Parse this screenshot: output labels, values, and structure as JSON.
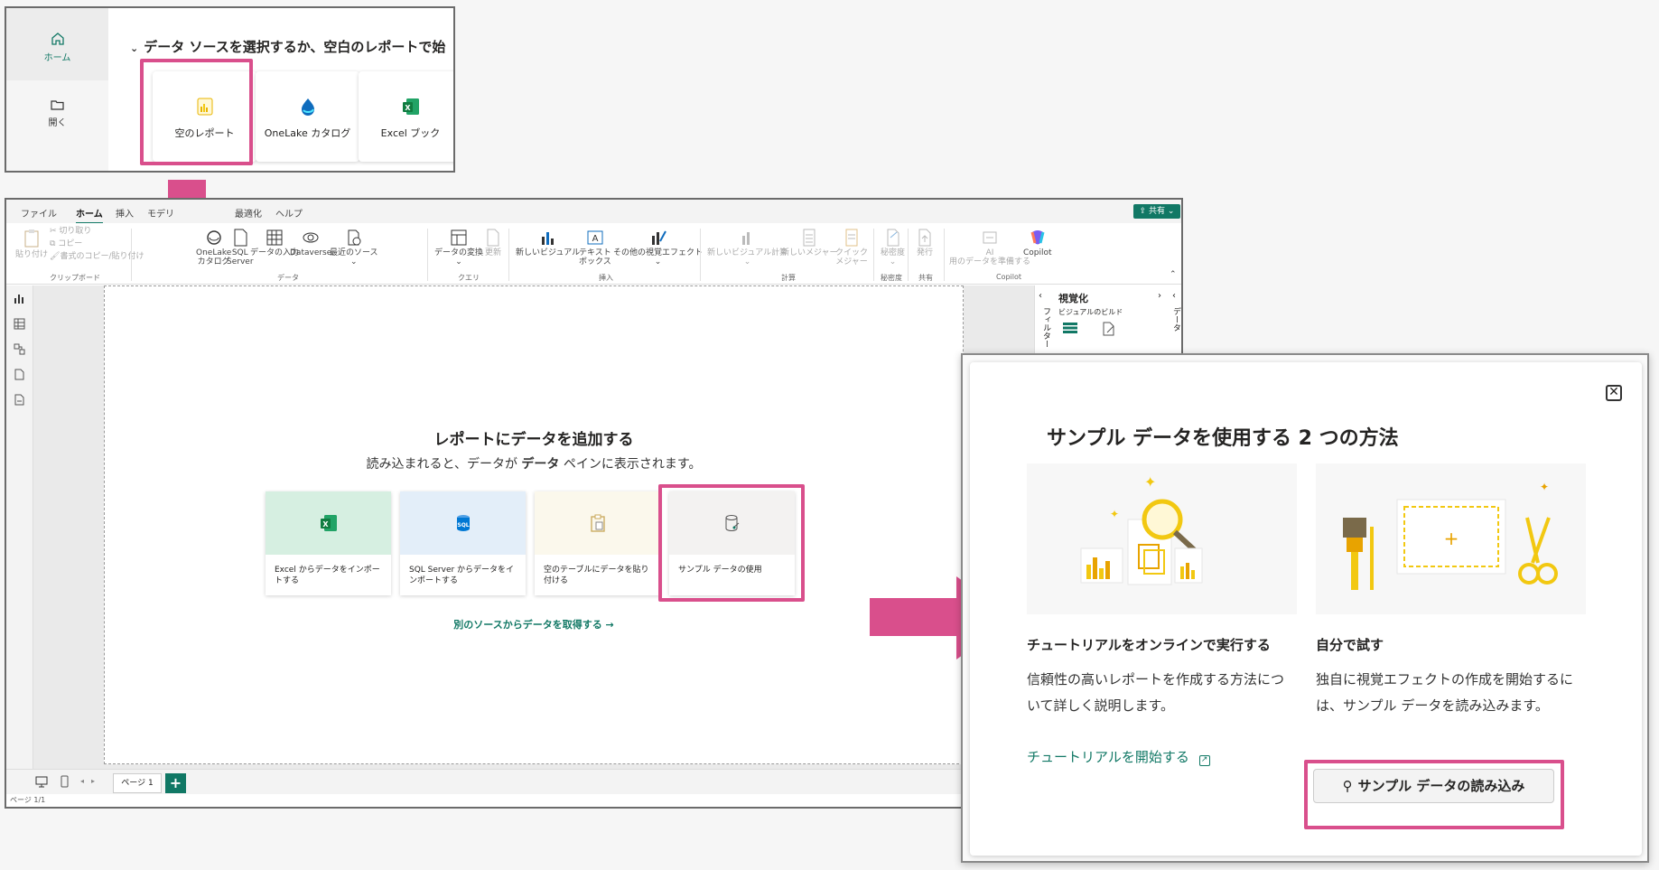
{
  "colors": {
    "accent": "#117865",
    "highlight": "#d94f8c",
    "excel": "#21a366",
    "sql": "#0078d4",
    "powerbi": "#f2c811"
  },
  "start_panel": {
    "nav": [
      {
        "label": "ホーム",
        "icon": "home-icon"
      },
      {
        "label": "開く",
        "icon": "folder-open-icon"
      }
    ],
    "header": "データ ソースを選択するか、空白のレポートで始",
    "cards": [
      {
        "label": "空のレポート",
        "icon": "blank-report-icon"
      },
      {
        "label": "OneLake カタログ",
        "icon": "onelake-icon"
      },
      {
        "label": "Excel ブック",
        "icon": "excel-icon"
      }
    ]
  },
  "pbi": {
    "menu_tabs": [
      "ファイル",
      "ホーム",
      "挿入",
      "モデリ",
      "最適化",
      "ヘルプ"
    ],
    "share_label": "共有",
    "ribbon": {
      "clipboard": {
        "paste": "貼り付け",
        "cut": "切り取り",
        "copy": "コピー",
        "format_painter": "書式のコピー/貼り付け",
        "group": "クリップボード"
      },
      "data": {
        "onelake": "OneLake\nカタログ",
        "sql": "SQL\nServer",
        "enter_data": "データの入力",
        "dataverse": "Dataverse",
        "recent": "最近のソース",
        "group": "データ"
      },
      "query": {
        "transform": "データの変換",
        "refresh": "更新",
        "group": "クエリ"
      },
      "insert": {
        "new_visual": "新しいビジュアル",
        "text_box": "テキスト\nボックス",
        "more_visuals": "その他の視覚エフェクト",
        "group": "挿入"
      },
      "calc": {
        "visual_calc": "新しいビジュアル計算",
        "new_measure": "新しいメジャー",
        "quick_measure": "クイック\nメジャー",
        "group": "計算"
      },
      "sensitivity": {
        "label": "秘密度",
        "group": "秘密度"
      },
      "share": {
        "publish": "発行",
        "group": "共有"
      },
      "copilot": {
        "ai": "AI\n用のデータを準備する",
        "copilot": "Copilot",
        "group": "Copilot"
      }
    },
    "canvas": {
      "title": "レポートにデータを追加する",
      "subtitle_a": "読み込まれると、データが ",
      "subtitle_b": "データ",
      "subtitle_c": " ペインに表示されます。",
      "cards": [
        {
          "label": "Excel からデータをインポートする",
          "icon": "excel-icon"
        },
        {
          "label": "SQL Server からデータをインポートする",
          "icon": "sql-icon"
        },
        {
          "label": "空のテーブルにデータを貼り付ける",
          "icon": "paste-table-icon"
        },
        {
          "label": "サンプル データの使用",
          "icon": "sample-data-icon"
        }
      ],
      "other_link": "別のソースからデータを取得する →"
    },
    "right_pane": {
      "viz_title": "視覚化",
      "build_label": "ビジュアルのビルド",
      "filter_label": "フィルター",
      "data_label": "データ"
    },
    "page_tab": "ページ 1",
    "add_page": "+",
    "status": "ページ 1/1"
  },
  "dialog": {
    "title": "サンプル データを使用する 2 つの方法",
    "close": "✕",
    "option1": {
      "title": "チュートリアルをオンラインで実行する",
      "desc": "信頼性の高いレポートを作成する方法について詳しく説明します。",
      "link": "チュートリアルを開始する"
    },
    "option2": {
      "title": "自分で試す",
      "desc": "独自に視覚エフェクトの作成を開始するには、サンプル データを読み込みます。",
      "button": "サンプル データの読み込み"
    }
  }
}
